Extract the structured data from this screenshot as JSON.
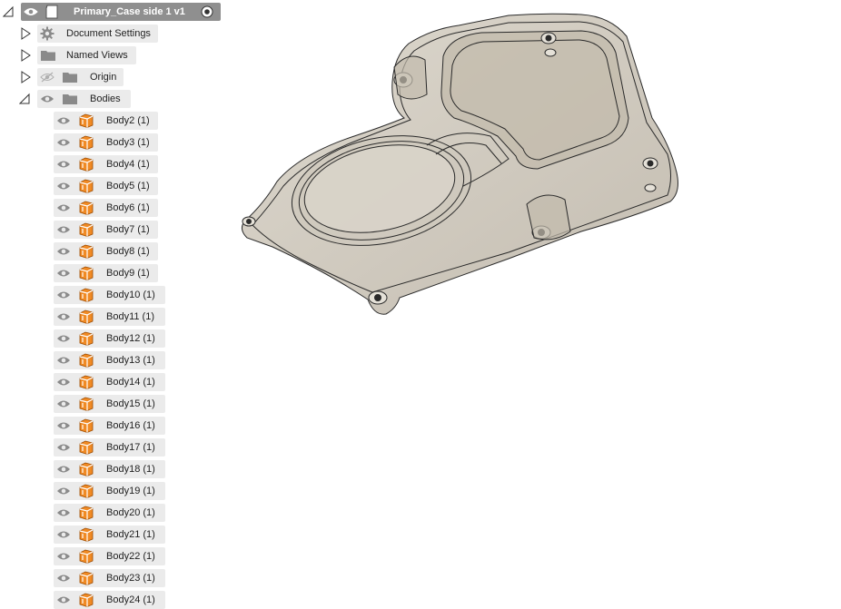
{
  "browser": {
    "root": {
      "label": "Primary_Case side 1 v1"
    },
    "nodes": [
      {
        "label": "Document Settings",
        "icon": "gear-icon"
      },
      {
        "label": "Named Views",
        "icon": "folder-icon"
      },
      {
        "label": "Origin",
        "icon": "folder-icon"
      },
      {
        "label": "Bodies",
        "icon": "folder-icon"
      }
    ],
    "bodies": [
      "Body2 (1)",
      "Body3 (1)",
      "Body4 (1)",
      "Body5 (1)",
      "Body6 (1)",
      "Body7 (1)",
      "Body8 (1)",
      "Body9 (1)",
      "Body10 (1)",
      "Body11 (1)",
      "Body12 (1)",
      "Body13 (1)",
      "Body14 (1)",
      "Body15 (1)",
      "Body16 (1)",
      "Body17 (1)",
      "Body18 (1)",
      "Body19 (1)",
      "Body20 (1)",
      "Body21 (1)",
      "Body22 (1)",
      "Body23 (1)",
      "Body24 (1)"
    ]
  },
  "colors": {
    "row_bg": "#ebebeb",
    "root_bg": "#8f8f8f",
    "body_icon": "#f08a24",
    "eye": "#8a8a8a",
    "model_fill": "#c9c2b5"
  }
}
